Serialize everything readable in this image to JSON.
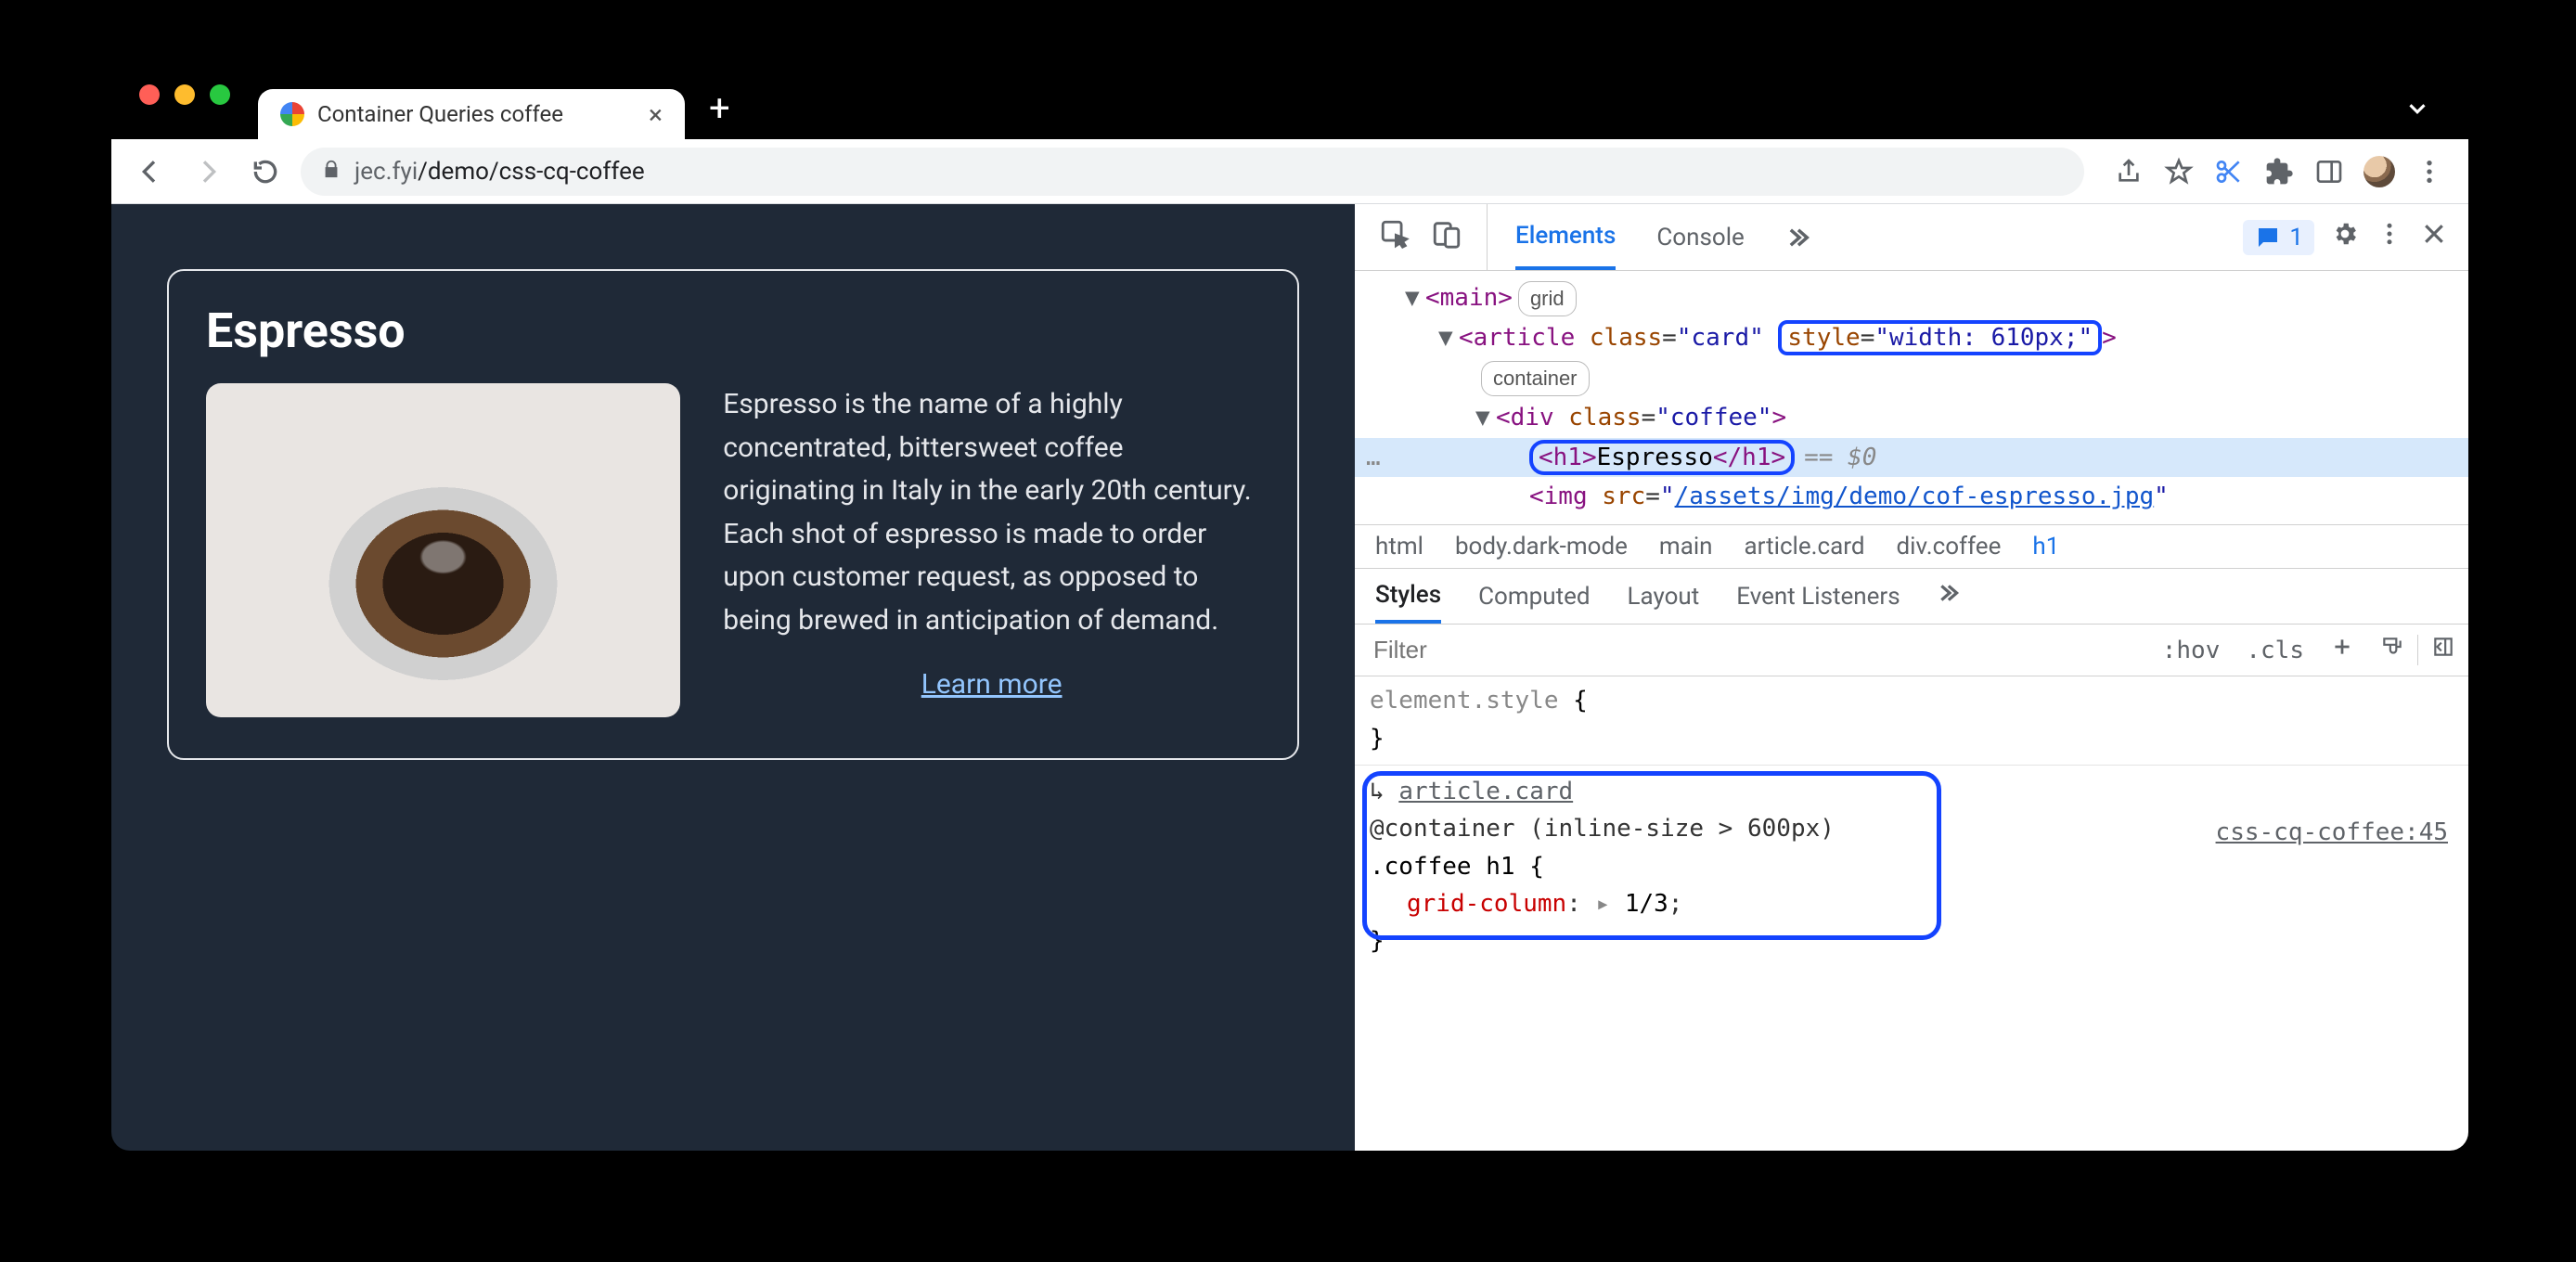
{
  "browser": {
    "tab_title": "Container Queries coffee",
    "url_host": "jec.fyi",
    "url_path": "/demo/css-cq-coffee"
  },
  "page": {
    "title": "Espresso",
    "description": "Espresso is the name of a highly concentrated, bittersweet coffee originating in Italy in the early 20th century. Each shot of espresso is made to order upon customer request, as opposed to being brewed in anticipation of demand.",
    "learn_more": "Learn more"
  },
  "devtools": {
    "tabs": {
      "elements": "Elements",
      "console": "Console"
    },
    "issues_count": "1",
    "dom": {
      "main_tag": "main",
      "main_badge": "grid",
      "article_tag": "article",
      "article_class_attr": "class",
      "article_class_val": "\"card\"",
      "article_style_attr": "style",
      "article_style_val": "\"width: 610px;\"",
      "article_badge": "container",
      "div_tag": "div",
      "div_class_attr": "class",
      "div_class_val": "\"coffee\"",
      "h1_open": "<h1>",
      "h1_text": "Espresso",
      "h1_close": "</h1>",
      "eq0": "== $0",
      "img_tag": "img",
      "img_src_attr": "src",
      "img_src_val": "/assets/img/demo/cof-espresso.jpg"
    },
    "crumbs": {
      "c1": "html",
      "c2": "body.dark-mode",
      "c3": "main",
      "c4": "article.card",
      "c5": "div.coffee",
      "c6": "h1"
    },
    "styles_tabs": {
      "styles": "Styles",
      "computed": "Computed",
      "layout": "Layout",
      "listeners": "Event Listeners"
    },
    "filter_placeholder": "Filter",
    "filter_buttons": {
      "hov": ":hov",
      "cls": ".cls"
    },
    "rules": {
      "r1_selector": "element.style",
      "r2_container_target": "article.card",
      "r2_container_query": "@container (inline-size > 600px)",
      "r2_selector": ".coffee h1",
      "r2_source": "css-cq-coffee:45",
      "r2_prop": "grid-column",
      "r2_val": "1/3"
    }
  }
}
